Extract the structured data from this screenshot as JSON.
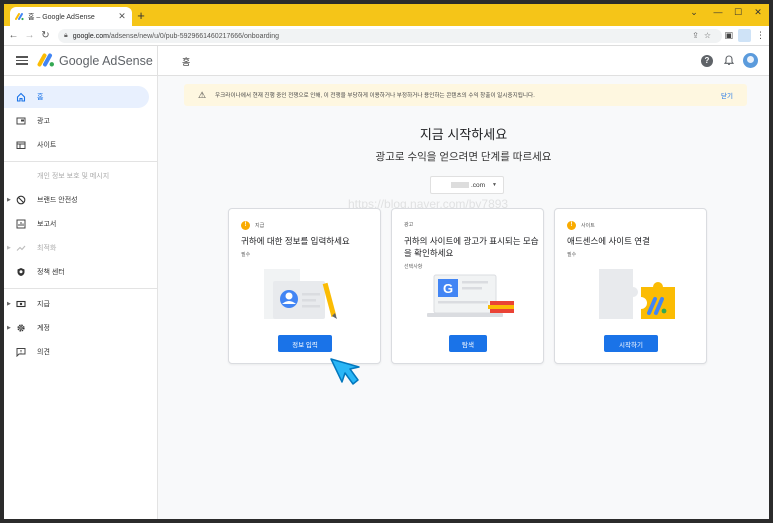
{
  "browser": {
    "tab_title": "홈 – Google AdSense",
    "tab_close": "✕",
    "new_tab": "+",
    "window_controls": [
      "⌄",
      "—",
      "☐",
      "✕"
    ],
    "url_host": "google.com",
    "url_path": "/adsense/new/u/0/pub-5929661460217666/onboarding"
  },
  "header": {
    "brand": "Google AdSense",
    "page_title": "홈"
  },
  "sidebar": {
    "items": [
      {
        "label": "홈",
        "icon": "home-icon"
      },
      {
        "label": "광고",
        "icon": "ads-icon"
      },
      {
        "label": "사이트",
        "icon": "sites-icon"
      },
      {
        "label": "개인 정보 보호 및 메시지",
        "icon": "privacy-icon"
      },
      {
        "label": "브랜드 안전성",
        "icon": "block-icon"
      },
      {
        "label": "보고서",
        "icon": "reports-icon"
      },
      {
        "label": "최적화",
        "icon": "trending-icon"
      },
      {
        "label": "정책 센터",
        "icon": "policy-icon"
      },
      {
        "label": "지급",
        "icon": "payments-icon"
      },
      {
        "label": "계정",
        "icon": "gear-icon"
      },
      {
        "label": "의견",
        "icon": "feedback-icon"
      }
    ]
  },
  "banner": {
    "text": "우크라이나에서 현재 진행 중인 전쟁으로 인해, 이 전쟁을 부당하게 이용하거나 부정하거나 용인하는 콘텐츠의 수익 창출이 일시중지됩니다.",
    "close": "닫기"
  },
  "main": {
    "heading": "지금 시작하세요",
    "subheading": "광고로 수익을 얻으려면 단계를 따르세요",
    "site_suffix": ".com",
    "watermark": "https://blog.naver.com/by7893"
  },
  "cards": [
    {
      "step": "지급",
      "title": "귀하에 대한 정보를 입력하세요",
      "sub": "필수",
      "button": "정보 입력"
    },
    {
      "step": "광고",
      "title": "귀하의 사이트에 광고가 표시되는 모습을 확인하세요",
      "sub": "선택사항",
      "button": "탐색"
    },
    {
      "step": "사이트",
      "title": "애드센스에 사이트 연결",
      "sub": "필수",
      "button": "시작하기"
    }
  ],
  "colors": {
    "accent": "#1a73e8",
    "warning": "#f9ab00",
    "banner_bg": "#fef7e0",
    "tabstrip": "#f5c518"
  }
}
